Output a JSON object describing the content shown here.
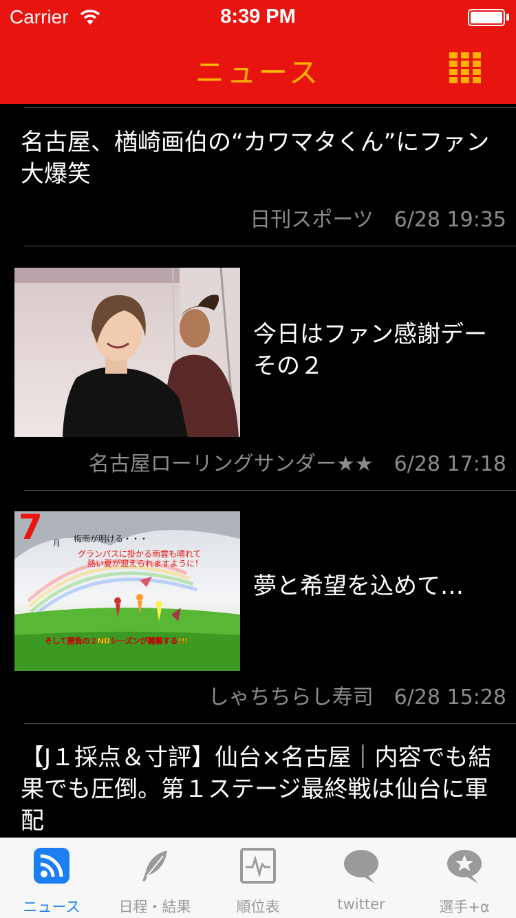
{
  "status_bar": {
    "carrier": "Carrier",
    "time": "8:39 PM"
  },
  "nav": {
    "title": "ニュース",
    "menu_icon": "grid-icon"
  },
  "colors": {
    "header": "#e8140f",
    "accent": "#ffb300",
    "tab_active": "#1b7ef3",
    "tab_inactive": "#9a9a9a"
  },
  "articles": [
    {
      "title": "名古屋、楢崎画伯の“カワマタくん”にファン大爆笑",
      "source": "日刊スポーツ",
      "time": "6/28 19:35"
    },
    {
      "title": "今日はファン感謝デーその２",
      "source": "名古屋ローリングサンダー★★",
      "time": "6/28 17:18"
    },
    {
      "title": "夢と希望を込めて…",
      "source": "しゃちちらし寿司",
      "time": "6/28 15:28",
      "image_text": {
        "month": "7",
        "month_suffix": "月",
        "line1": "梅雨が明ける・・・",
        "line2": "グランパスに掛かる雨雲も晴れて",
        "line3": "熱い夏が迎えられますように！",
        "line4": "そして勝負の２NDシーズンが開幕する!!!"
      }
    },
    {
      "title": "【J１採点＆寸評】仙台×名古屋｜内容でも結果でも圧倒。第１ステージ最終戦は仙台に軍配"
    }
  ],
  "tabs": [
    {
      "label": "ニュース",
      "icon": "rss-icon",
      "active": true
    },
    {
      "label": "日程・結果",
      "icon": "feather-icon",
      "active": false
    },
    {
      "label": "順位表",
      "icon": "chart-icon",
      "active": false
    },
    {
      "label": "twitter",
      "icon": "speech-bubble-icon",
      "active": false
    },
    {
      "label": "選手+α",
      "icon": "star-bubble-icon",
      "active": false
    }
  ]
}
